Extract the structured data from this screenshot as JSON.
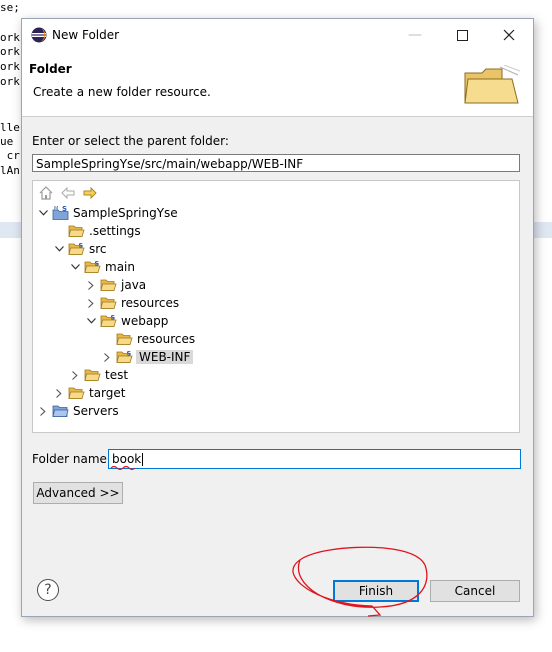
{
  "background": {
    "code_fragments": [
      "se;",
      "",
      "ork",
      "ork",
      "ork",
      "ork",
      "",
      "",
      "lle",
      "ue",
      " cr",
      "lAn"
    ]
  },
  "dialog": {
    "title": "New Folder",
    "header": {
      "title": "Folder",
      "description": "Create a new folder resource."
    },
    "parent_label": "Enter or select the parent folder:",
    "parent_path": "SampleSpringYse/src/main/webapp/WEB-INF",
    "tree": [
      {
        "label": "SampleSpringYse",
        "expanded": true,
        "type": "project"
      },
      {
        "label": ".settings",
        "type": "folder"
      },
      {
        "label": "src",
        "expanded": true,
        "type": "source-folder"
      },
      {
        "label": "main",
        "expanded": true,
        "type": "source-folder"
      },
      {
        "label": "java",
        "expanded": false,
        "type": "folder"
      },
      {
        "label": "resources",
        "expanded": false,
        "type": "folder"
      },
      {
        "label": "webapp",
        "expanded": true,
        "type": "source-folder"
      },
      {
        "label": "resources",
        "type": "folder"
      },
      {
        "label": "WEB-INF",
        "expanded": false,
        "type": "source-folder",
        "selected": true
      },
      {
        "label": "test",
        "expanded": false,
        "type": "folder"
      },
      {
        "label": "target",
        "expanded": false,
        "type": "folder"
      },
      {
        "label": "Servers",
        "expanded": false,
        "type": "project-folder"
      }
    ],
    "folder_name_label": "Folder name:",
    "folder_name_value": "book",
    "advanced_label": "Advanced >>",
    "help_symbol": "?",
    "finish_label": "Finish",
    "cancel_label": "Cancel"
  },
  "colors": {
    "folder": "#e8b649",
    "focus_border": "#0078d7",
    "annotation": "#e0141e"
  }
}
